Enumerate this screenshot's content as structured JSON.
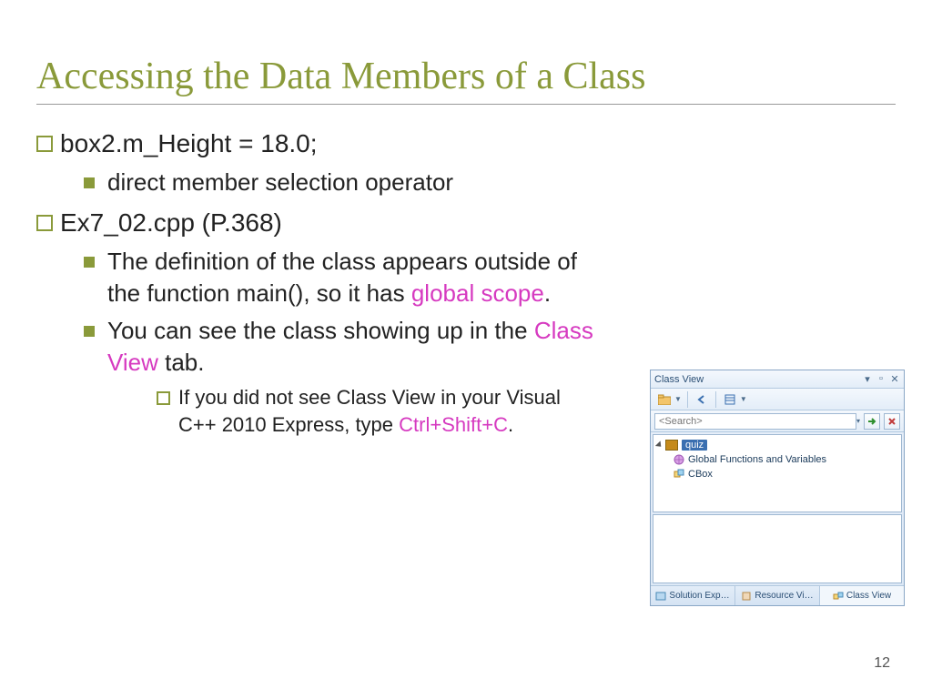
{
  "title": "Accessing the Data Members of a Class",
  "bullets": {
    "b1": "box2.m_Height = 18.0;",
    "b1a": "direct member selection operator",
    "b2": "Ex7_02.cpp (P.368)",
    "b2a_pre": "The definition of the class appears outside of the function main(), so it has ",
    "b2a_span": "global scope",
    "b2a_post": ".",
    "b2b_pre": "You can see the class showing up in the ",
    "b2b_span": "Class View",
    "b2b_post": " tab.",
    "b2b1_pre": "If you did not see Class View in your Visual C++ 2010 Express, type ",
    "b2b1_span": "Ctrl+Shift+C",
    "b2b1_post": "."
  },
  "page_number": "12",
  "classview": {
    "header": "Class View",
    "search_placeholder": "<Search>",
    "tree": {
      "project": "quiz",
      "node_globals": "Global Functions and Variables",
      "node_cbox": "CBox"
    },
    "tabs": {
      "t1": "Solution Exp…",
      "t2": "Resource Vi…",
      "t3": "Class View"
    }
  }
}
